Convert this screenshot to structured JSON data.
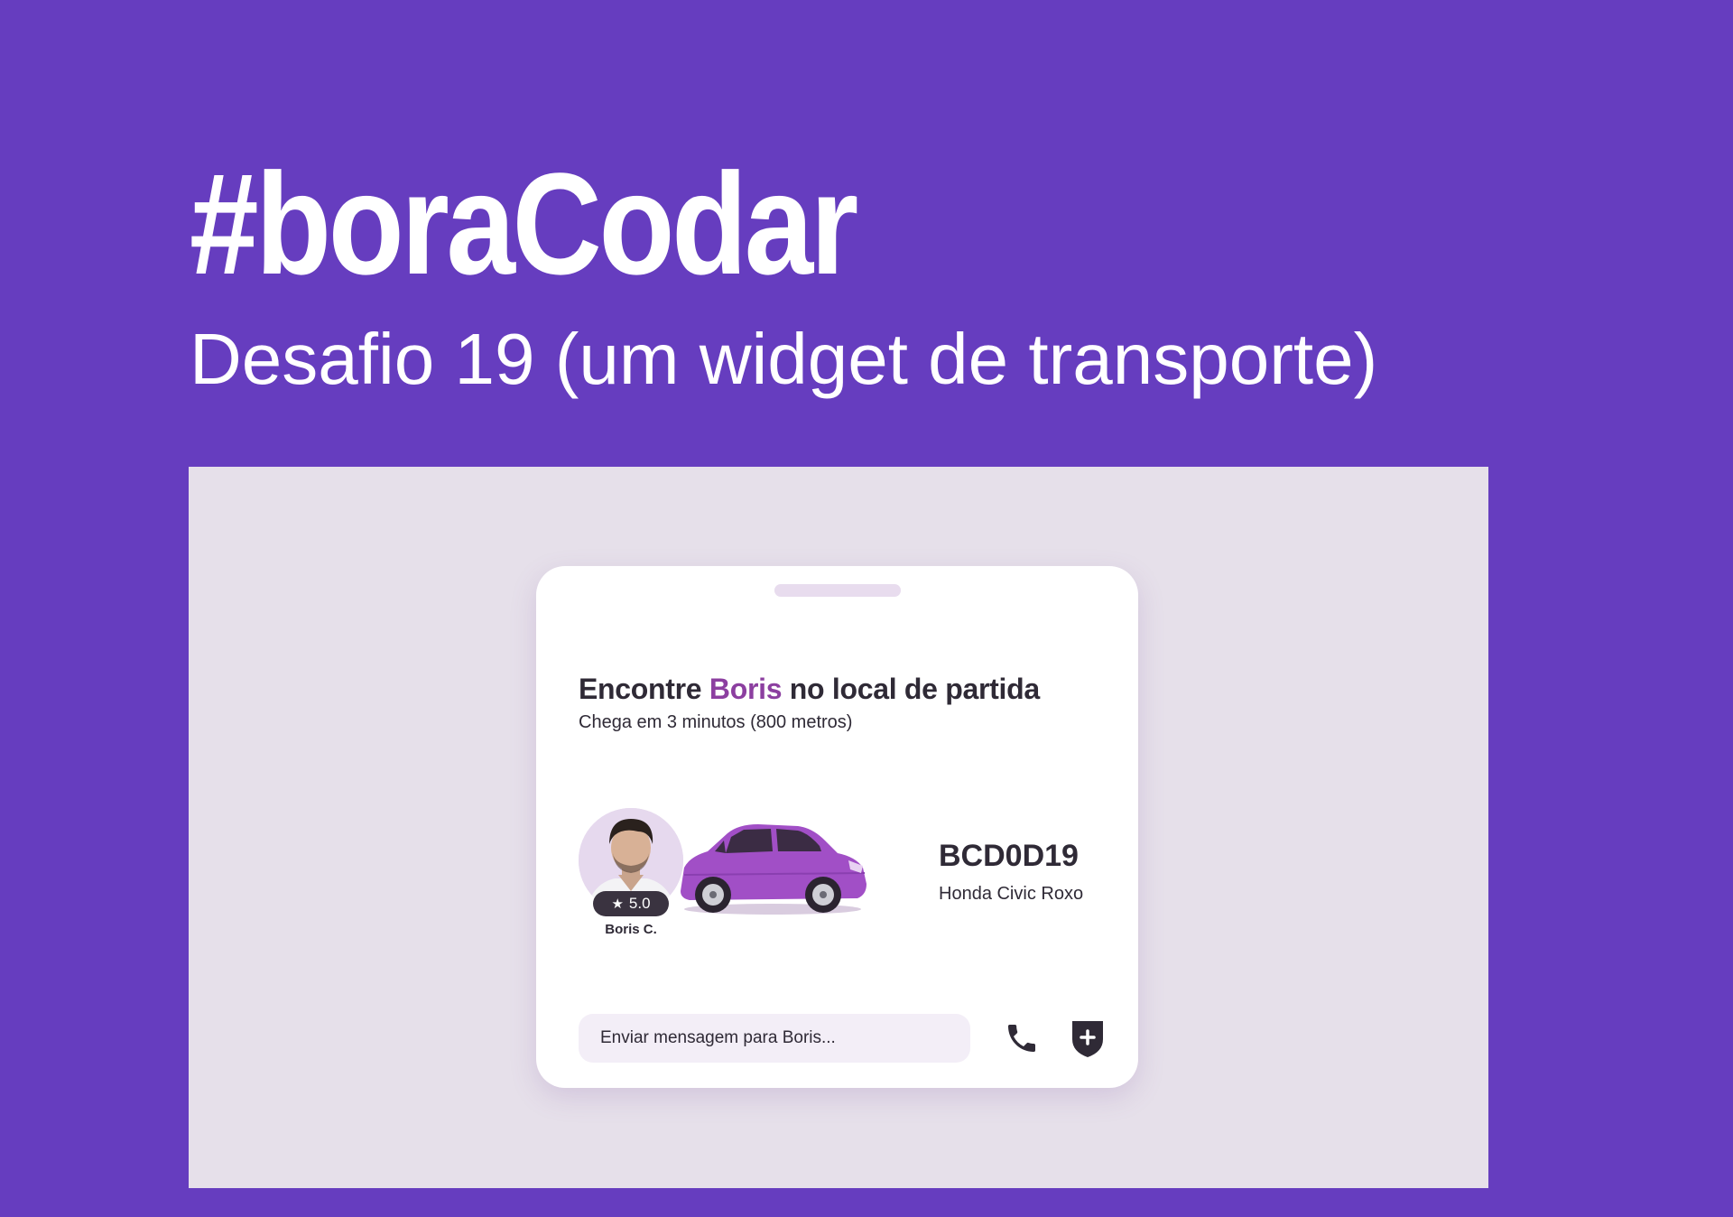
{
  "header": {
    "title": "#boraCodar",
    "subtitle": "Desafio 19 (um widget de transporte)"
  },
  "widget": {
    "headline_prefix": "Encontre ",
    "driver_highlight": "Boris",
    "headline_suffix": " no local de partida",
    "eta": "Chega em 3 minutos (800 metros)",
    "driver": {
      "name": "Boris C.",
      "rating": "5.0",
      "rating_icon": "star-icon",
      "avatar_icon": "driver-avatar"
    },
    "car": {
      "plate": "BCD0D19",
      "model": "Honda Civic Roxo",
      "icon": "car-illustration"
    },
    "message": {
      "placeholder": "Enviar mensagem para Boris..."
    },
    "actions": {
      "phone_icon": "phone-icon",
      "safety_icon": "shield-plus-icon"
    }
  },
  "colors": {
    "background": "#663dbf",
    "stage": "#e6e0ea",
    "card": "#ffffff",
    "accent": "#8c3fa0",
    "text": "#2f2a36",
    "input_bg": "#f3eef7",
    "car_body": "#a14fc6"
  }
}
